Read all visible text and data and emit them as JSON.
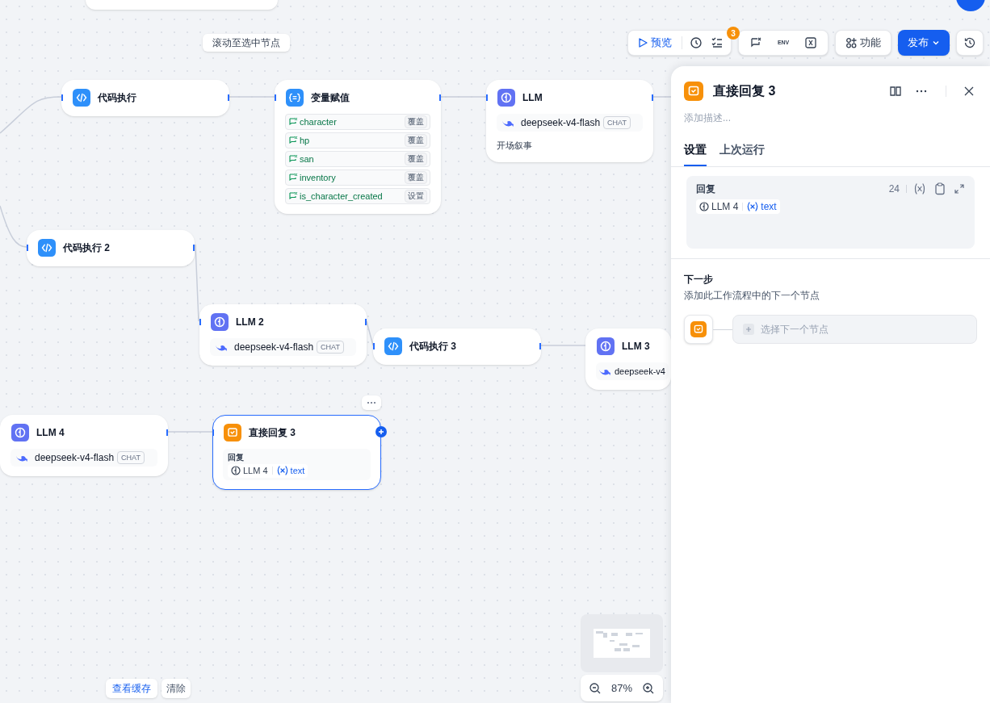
{
  "canvas": {
    "scroll_hint": "滚动至选中节点"
  },
  "toolbar": {
    "preview": "预览",
    "checklist_count": "3",
    "env": "ENV",
    "features": "功能",
    "publish": "发布"
  },
  "nodes": [
    {
      "kind": "code",
      "title": "代码执行",
      "selected": false
    },
    {
      "kind": "assigner",
      "title": "变量赋值",
      "selected": false,
      "items": [
        {
          "variable": "character",
          "operation": "覆盖"
        },
        {
          "variable": "hp",
          "operation": "覆盖"
        },
        {
          "variable": "san",
          "operation": "覆盖"
        },
        {
          "variable": "inventory",
          "operation": "覆盖"
        },
        {
          "variable": "is_character_created",
          "operation": "设置"
        }
      ]
    },
    {
      "kind": "llm",
      "title": "LLM",
      "selected": false,
      "model": "deepseek-v4-flash",
      "mode": "CHAT",
      "description": "开场叙事"
    },
    {
      "kind": "code",
      "title": "代码执行 2",
      "selected": false
    },
    {
      "kind": "llm",
      "title": "LLM 2",
      "selected": false,
      "model": "deepseek-v4-flash",
      "mode": "CHAT"
    },
    {
      "kind": "code",
      "title": "代码执行 3",
      "selected": false
    },
    {
      "kind": "llm",
      "title": "LLM 3",
      "selected": false,
      "model": "deepseek-v4"
    },
    {
      "kind": "llm",
      "title": "LLM 4",
      "selected": false,
      "model": "deepseek-v4-flash",
      "mode": "CHAT"
    },
    {
      "kind": "answer",
      "title": "直接回复 3",
      "selected": true,
      "label": "回复",
      "source": "LLM 4",
      "variable": "text"
    }
  ],
  "panel": {
    "title": "直接回复 3",
    "description_placeholder": "添加描述...",
    "tabs": [
      {
        "label": "设置",
        "selected": true
      },
      {
        "label": "上次运行",
        "selected": false
      }
    ],
    "reply": {
      "label": "回复",
      "count": "24",
      "source": "LLM 4",
      "variable": "text"
    },
    "next_step": {
      "title": "下一步",
      "description": "添加此工作流程中的下一个节点",
      "select": "选择下一个节点"
    }
  },
  "footer": {
    "view_cache": "查看缓存",
    "clear": "清除",
    "zoom": "87%"
  }
}
